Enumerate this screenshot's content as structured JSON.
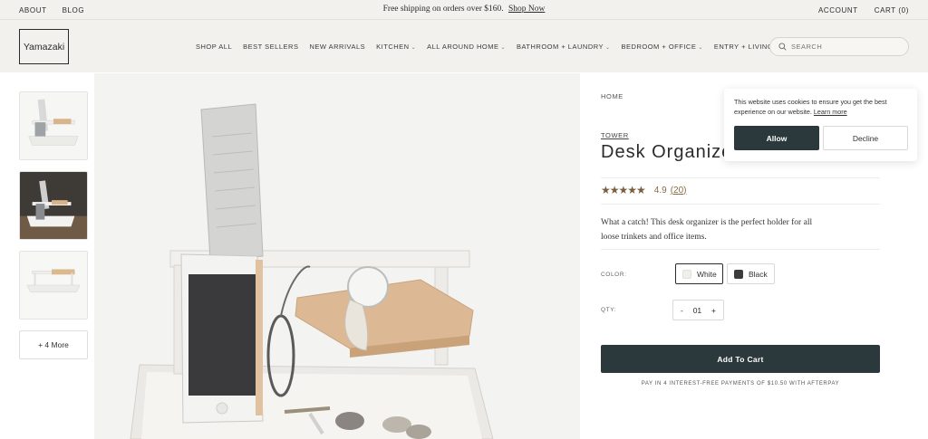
{
  "topbar": {
    "left_links": [
      "ABOUT",
      "BLOG"
    ],
    "announcement": "Free shipping on orders over $160.",
    "announcement_link": "Shop Now",
    "right_links": [
      "ACCOUNT",
      "CART (0)"
    ]
  },
  "header": {
    "logo": "Yamazaki",
    "nav": [
      {
        "label": "SHOP ALL",
        "dropdown": false
      },
      {
        "label": "BEST SELLERS",
        "dropdown": false
      },
      {
        "label": "NEW ARRIVALS",
        "dropdown": false
      },
      {
        "label": "KITCHEN",
        "dropdown": true
      },
      {
        "label": "ALL AROUND HOME",
        "dropdown": true
      },
      {
        "label": "BATHROOM + LAUNDRY",
        "dropdown": true
      },
      {
        "label": "BEDROOM + OFFICE",
        "dropdown": true
      },
      {
        "label": "ENTRY + LIVING",
        "dropdown": true
      }
    ],
    "search_placeholder": "SEARCH",
    "chevron": "⌄"
  },
  "gallery": {
    "more_label": "+ 4 More"
  },
  "product": {
    "breadcrumb": "HOME",
    "vendor": "TOWER",
    "title": "Desk Organizer",
    "rating": "4.9",
    "stars": "★★★★★",
    "rating_fraction": 0.98,
    "review_count": "(20)",
    "description": "What a catch! This desk organizer is the perfect holder for all loose trinkets and office items.",
    "color_label": "COLOR:",
    "colors": [
      {
        "name": "White",
        "hex": "#f1efec",
        "selected": true
      },
      {
        "name": "Black",
        "hex": "#3a3d40",
        "selected": false
      }
    ],
    "qty_label": "QTY:",
    "qty_minus": "-",
    "qty_value": "01",
    "qty_plus": "+",
    "add_to_cart": "Add To Cart",
    "afterpay_text": "PAY IN 4 INTEREST-FREE PAYMENTS OF $10.50 WITH AFTERPAY"
  },
  "cookie": {
    "message": "This website uses cookies to ensure you get the best experience on our website.",
    "learn_more": "Learn more",
    "allow": "Allow",
    "decline": "Decline"
  },
  "colors": {
    "accent_dark": "#2b383c",
    "header_bg": "#f2f1ee",
    "star_color": "#7a5f3d"
  }
}
